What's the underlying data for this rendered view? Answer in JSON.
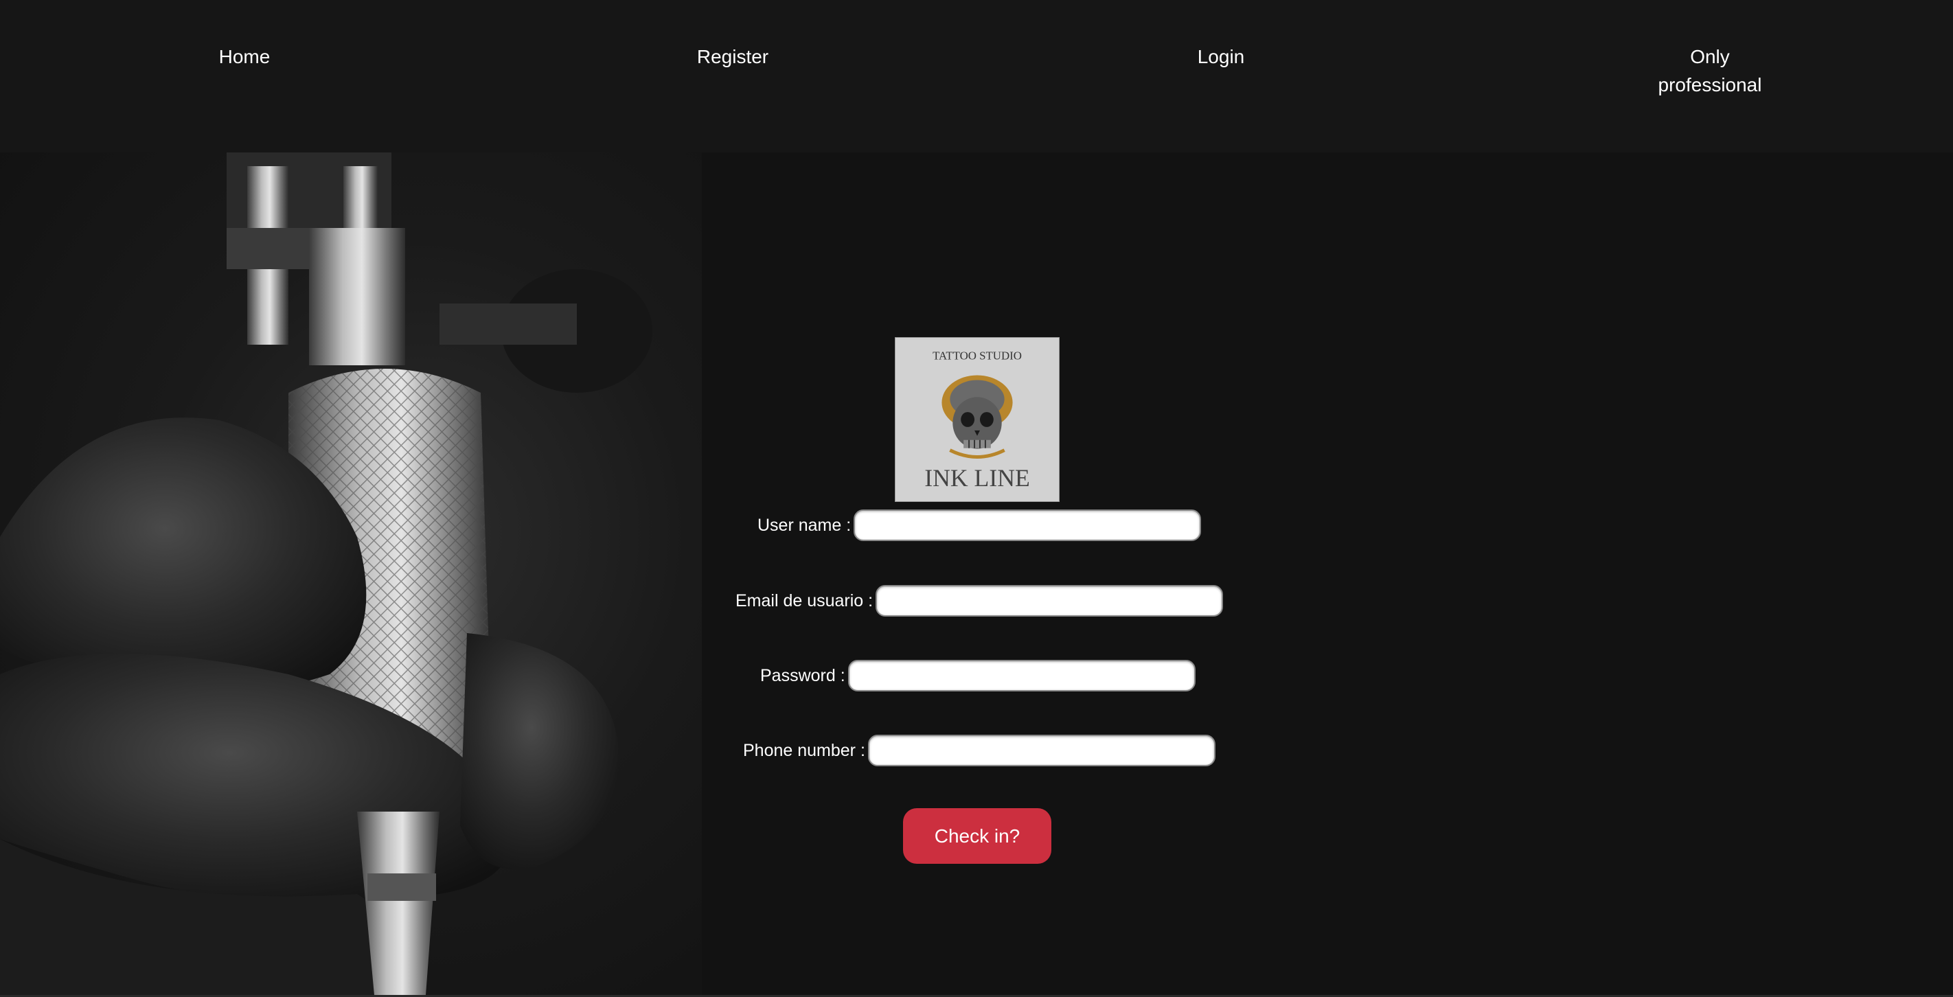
{
  "nav": {
    "home": "Home",
    "register": "Register",
    "login": "Login",
    "only_professional": "Only professional"
  },
  "logo": {
    "top_text": "TATTOO STUDIO",
    "brand_text": "INK LINE",
    "icon": "skull-icon"
  },
  "form": {
    "username_label": "User name :",
    "email_label": "Email de usuario :",
    "password_label": "Password :",
    "phone_label": "Phone number :",
    "username_value": "",
    "email_value": "",
    "password_value": "",
    "phone_value": "",
    "submit_label": "Check in?"
  },
  "colors": {
    "background": "#121212",
    "navbar": "#161616",
    "accent": "#cc2f3f",
    "text": "#ffffff"
  }
}
